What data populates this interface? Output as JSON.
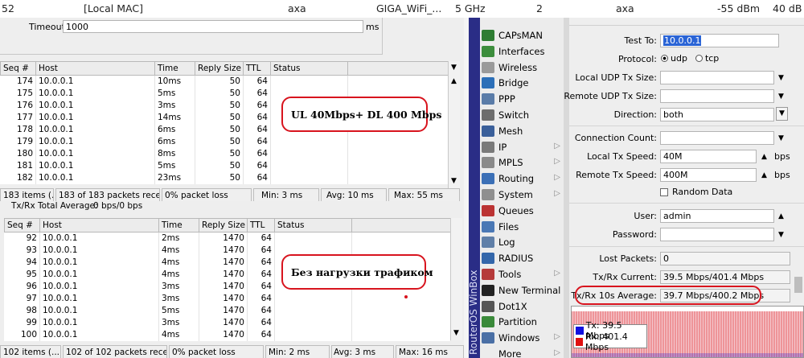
{
  "top_strip": {
    "c1": "52",
    "c2": "[Local MAC]",
    "c3": "axa",
    "c4": "GIGA_WiFi_...",
    "c5": "5 GHz",
    "c6": "2",
    "c7": "axa",
    "c8": "-55 dBm",
    "c9": "40 dB"
  },
  "ping1": {
    "timeout_label": "Timeout:",
    "timeout_value": "1000",
    "timeout_unit": "ms",
    "columns": [
      "Seq #",
      "Host",
      "Time",
      "Reply Size",
      "TTL",
      "Status"
    ],
    "rows": [
      [
        "174",
        "10.0.0.1",
        "10ms",
        "50",
        "64",
        ""
      ],
      [
        "175",
        "10.0.0.1",
        "5ms",
        "50",
        "64",
        ""
      ],
      [
        "176",
        "10.0.0.1",
        "3ms",
        "50",
        "64",
        ""
      ],
      [
        "177",
        "10.0.0.1",
        "14ms",
        "50",
        "64",
        ""
      ],
      [
        "178",
        "10.0.0.1",
        "6ms",
        "50",
        "64",
        ""
      ],
      [
        "179",
        "10.0.0.1",
        "6ms",
        "50",
        "64",
        ""
      ],
      [
        "180",
        "10.0.0.1",
        "8ms",
        "50",
        "64",
        ""
      ],
      [
        "181",
        "10.0.0.1",
        "5ms",
        "50",
        "64",
        ""
      ],
      [
        "182",
        "10.0.0.1",
        "23ms",
        "50",
        "64",
        ""
      ]
    ],
    "status": [
      "183 items (...",
      "183 of 183 packets receiv...",
      "0% packet loss",
      "Min: 3 ms",
      "Avg: 10 ms",
      "Max: 55 ms"
    ],
    "callout": "UL 40Mbps+ DL 400 Mbps"
  },
  "txrx_total": "Tx/Rx Total Average:",
  "txrx_total_value": "0 bps/0 bps",
  "ping2": {
    "columns": [
      "Seq #",
      "Host",
      "Time",
      "Reply Size",
      "TTL",
      "Status"
    ],
    "rows": [
      [
        "92",
        "10.0.0.1",
        "2ms",
        "1470",
        "64",
        ""
      ],
      [
        "93",
        "10.0.0.1",
        "4ms",
        "1470",
        "64",
        ""
      ],
      [
        "94",
        "10.0.0.1",
        "4ms",
        "1470",
        "64",
        ""
      ],
      [
        "95",
        "10.0.0.1",
        "4ms",
        "1470",
        "64",
        ""
      ],
      [
        "96",
        "10.0.0.1",
        "3ms",
        "1470",
        "64",
        ""
      ],
      [
        "97",
        "10.0.0.1",
        "3ms",
        "1470",
        "64",
        ""
      ],
      [
        "98",
        "10.0.0.1",
        "5ms",
        "1470",
        "64",
        ""
      ],
      [
        "99",
        "10.0.0.1",
        "3ms",
        "1470",
        "64",
        ""
      ],
      [
        "100",
        "10.0.0.1",
        "4ms",
        "1470",
        "64",
        ""
      ]
    ],
    "status": [
      "102 items (...",
      "102 of 102 packets receiv...",
      "0% packet loss",
      "Min: 2 ms",
      "Avg: 3 ms",
      "Max: 16 ms"
    ],
    "callout": "Без нагрузки трафиком"
  },
  "menu": {
    "brand": "RouterOS WinBox",
    "items": [
      {
        "label": "CAPsMAN",
        "color": "#2e7d32",
        "arrow": false
      },
      {
        "label": "Interfaces",
        "color": "#3c8d3c",
        "arrow": false
      },
      {
        "label": "Wireless",
        "color": "#9a9a9a",
        "arrow": false
      },
      {
        "label": "Bridge",
        "color": "#2c6fb8",
        "arrow": false
      },
      {
        "label": "PPP",
        "color": "#5a7ca8",
        "arrow": false
      },
      {
        "label": "Switch",
        "color": "#6d6d6d",
        "arrow": false
      },
      {
        "label": "Mesh",
        "color": "#3a5f9a",
        "arrow": false
      },
      {
        "label": "IP",
        "color": "#7a7a7a",
        "arrow": true
      },
      {
        "label": "MPLS",
        "color": "#8a8a8a",
        "arrow": true
      },
      {
        "label": "Routing",
        "color": "#3b6fb6",
        "arrow": true
      },
      {
        "label": "System",
        "color": "#8f8f8f",
        "arrow": true
      },
      {
        "label": "Queues",
        "color": "#b33",
        "arrow": false
      },
      {
        "label": "Files",
        "color": "#4a78b5",
        "arrow": false
      },
      {
        "label": "Log",
        "color": "#5f7fa8",
        "arrow": false
      },
      {
        "label": "RADIUS",
        "color": "#3366aa",
        "arrow": false
      },
      {
        "label": "Tools",
        "color": "#b53a3a",
        "arrow": true
      },
      {
        "label": "New Terminal",
        "color": "#222",
        "arrow": false
      },
      {
        "label": "Dot1X",
        "color": "#555",
        "arrow": false
      },
      {
        "label": "Partition",
        "color": "#3a8a3a",
        "arrow": false
      },
      {
        "label": "Windows",
        "color": "#4a6fa5",
        "arrow": true
      },
      {
        "label": "More",
        "color": "#ececec",
        "arrow": true
      }
    ]
  },
  "btest": {
    "test_to_label": "Test To:",
    "test_to_value": "10.0.0.1",
    "protocol_label": "Protocol:",
    "protocol_options": [
      "udp",
      "tcp"
    ],
    "local_udp_label": "Local UDP Tx Size:",
    "remote_udp_label": "Remote UDP Tx Size:",
    "direction_label": "Direction:",
    "direction_value": "both",
    "conn_count_label": "Connection Count:",
    "local_tx_label": "Local Tx Speed:",
    "local_tx_value": "40M",
    "remote_tx_label": "Remote Tx Speed:",
    "remote_tx_value": "400M",
    "bps": "bps",
    "random_data": "Random Data",
    "user_label": "User:",
    "user_value": "admin",
    "password_label": "Password:",
    "lost_packets_label": "Lost Packets:",
    "lost_packets_value": "0",
    "txrx_current_label": "Tx/Rx Current:",
    "txrx_current_value": "39.5 Mbps/401.4 Mbps",
    "txrx_10s_label": "Tx/Rx 10s Average:",
    "txrx_10s_value": "39.7 Mbps/400.2 Mbps",
    "legend_tx": "Tx:  39.5 Mbps",
    "legend_rx": "Rx:  401.4 Mbps",
    "tx_color": "#1010e0",
    "rx_color": "#e01010"
  }
}
